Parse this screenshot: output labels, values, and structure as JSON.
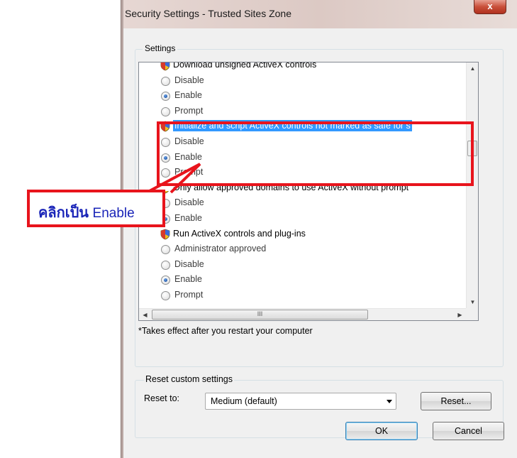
{
  "window": {
    "title": "Security Settings - Trusted Sites Zone",
    "close_glyph": "x"
  },
  "settings": {
    "legend": "Settings",
    "tree": [
      {
        "type": "category",
        "label": "Download unsigned ActiveX controls"
      },
      {
        "type": "option",
        "label": "Disable",
        "checked": false
      },
      {
        "type": "option",
        "label": "Enable",
        "checked": true
      },
      {
        "type": "option",
        "label": "Prompt",
        "checked": false
      },
      {
        "type": "category",
        "label": "Initialize and script ActiveX controls not marked as safe for s",
        "selected": true
      },
      {
        "type": "option",
        "label": "Disable",
        "checked": false
      },
      {
        "type": "option",
        "label": "Enable",
        "checked": true
      },
      {
        "type": "option",
        "label": "Prompt",
        "checked": false
      },
      {
        "type": "category",
        "label": "Only allow approved domains to use ActiveX without prompt"
      },
      {
        "type": "option",
        "label": "Disable",
        "checked": false
      },
      {
        "type": "option",
        "label": "Enable",
        "checked": true
      },
      {
        "type": "category",
        "label": "Run ActiveX controls and plug-ins"
      },
      {
        "type": "option",
        "label": "Administrator approved",
        "checked": false
      },
      {
        "type": "option",
        "label": "Disable",
        "checked": false
      },
      {
        "type": "option",
        "label": "Enable",
        "checked": true
      },
      {
        "type": "option",
        "label": "Prompt",
        "checked": false
      }
    ],
    "scroll_up": "▲",
    "scroll_down": "▼",
    "scroll_left": "◀",
    "scroll_right": "▶",
    "hthumb_grip": "III",
    "note": "*Takes effect after you restart your computer"
  },
  "reset": {
    "legend": "Reset custom settings",
    "label": "Reset to:",
    "value": "Medium (default)",
    "button": "Reset..."
  },
  "buttons": {
    "ok": "OK",
    "cancel": "Cancel"
  },
  "annotation": {
    "text_thai": "คลิกเป็น",
    "text_en": "Enable",
    "color": "#e8141c",
    "text_color": "#1a25b8"
  }
}
